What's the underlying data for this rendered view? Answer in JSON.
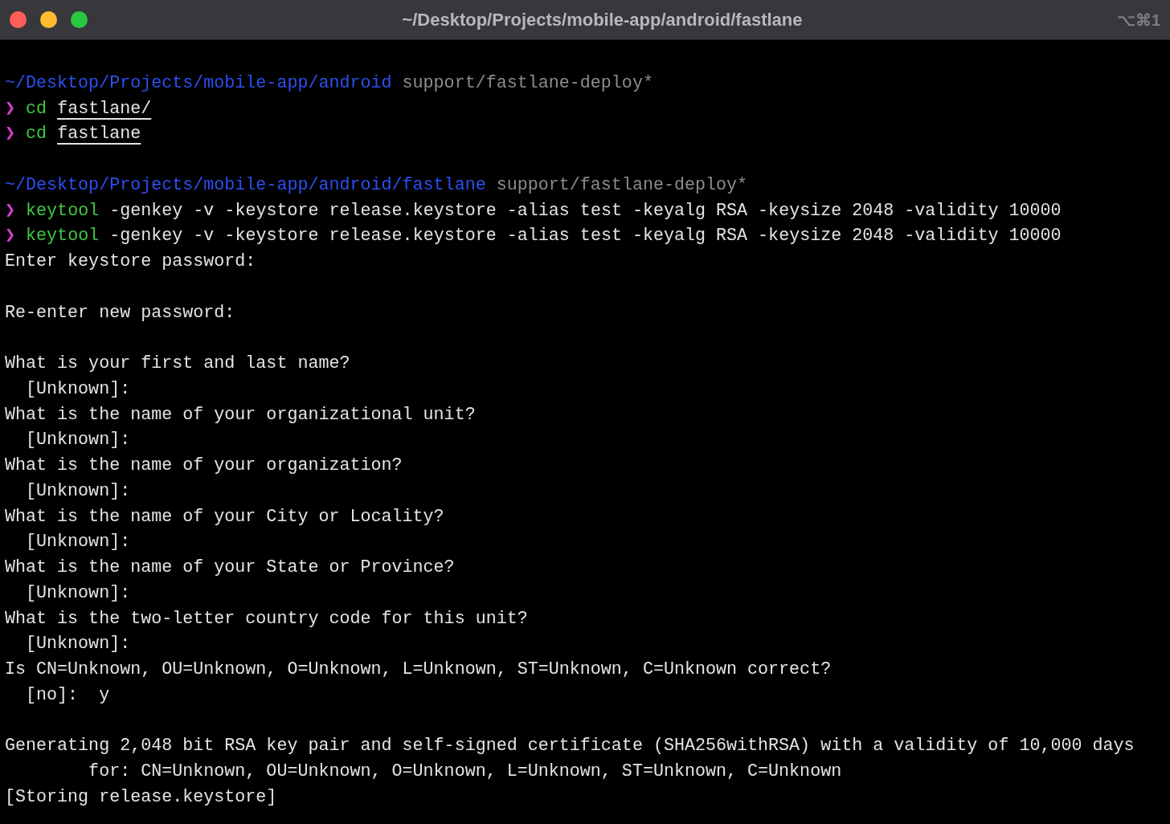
{
  "window": {
    "title": "~/Desktop/Projects/mobile-app/android/fastlane",
    "shortcut": "⌥⌘1"
  },
  "lines": [
    {
      "kind": "blank"
    },
    {
      "kind": "prompt",
      "path": "~/Desktop/Projects/mobile-app/android",
      "branch": "support/fastlane-deploy*"
    },
    {
      "kind": "command",
      "symbol": "❯",
      "program": "cd",
      "args": "fastlane/",
      "args_underlined": true
    },
    {
      "kind": "command",
      "symbol": "❯",
      "program": "cd",
      "args": "fastlane",
      "args_underlined": true
    },
    {
      "kind": "blank"
    },
    {
      "kind": "prompt",
      "path": "~/Desktop/Projects/mobile-app/android/fastlane",
      "branch": "support/fastlane-deploy*"
    },
    {
      "kind": "command",
      "symbol": "❯",
      "program": "keytool",
      "args": "-genkey -v -keystore release.keystore -alias test -keyalg RSA -keysize 2048 -validity 10000",
      "args_underlined": false
    },
    {
      "kind": "command",
      "symbol": "❯",
      "program": "keytool",
      "args": "-genkey -v -keystore release.keystore -alias test -keyalg RSA -keysize 2048 -validity 10000",
      "args_underlined": false
    },
    {
      "kind": "output",
      "text": "Enter keystore password:"
    },
    {
      "kind": "blank"
    },
    {
      "kind": "output",
      "text": "Re-enter new password:"
    },
    {
      "kind": "blank"
    },
    {
      "kind": "output",
      "text": "What is your first and last name?"
    },
    {
      "kind": "output",
      "text": "  [Unknown]:"
    },
    {
      "kind": "output",
      "text": "What is the name of your organizational unit?"
    },
    {
      "kind": "output",
      "text": "  [Unknown]:"
    },
    {
      "kind": "output",
      "text": "What is the name of your organization?"
    },
    {
      "kind": "output",
      "text": "  [Unknown]:"
    },
    {
      "kind": "output",
      "text": "What is the name of your City or Locality?"
    },
    {
      "kind": "output",
      "text": "  [Unknown]:"
    },
    {
      "kind": "output",
      "text": "What is the name of your State or Province?"
    },
    {
      "kind": "output",
      "text": "  [Unknown]:"
    },
    {
      "kind": "output",
      "text": "What is the two-letter country code for this unit?"
    },
    {
      "kind": "output",
      "text": "  [Unknown]:"
    },
    {
      "kind": "output",
      "text": "Is CN=Unknown, OU=Unknown, O=Unknown, L=Unknown, ST=Unknown, C=Unknown correct?"
    },
    {
      "kind": "output",
      "text": "  [no]:  y"
    },
    {
      "kind": "blank"
    },
    {
      "kind": "output",
      "text": "Generating 2,048 bit RSA key pair and self-signed certificate (SHA256withRSA) with a validity of 10,000 days"
    },
    {
      "kind": "output",
      "text": "        for: CN=Unknown, OU=Unknown, O=Unknown, L=Unknown, ST=Unknown, C=Unknown"
    },
    {
      "kind": "output",
      "text": "[Storing release.keystore]"
    }
  ]
}
